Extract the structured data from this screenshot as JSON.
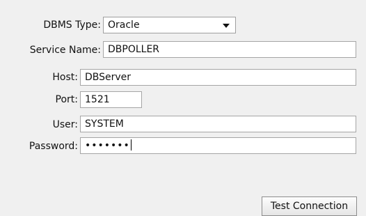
{
  "form": {
    "dbms_type": {
      "label": "DBMS Type:",
      "value": "Oracle",
      "icon": "chevron-down-icon"
    },
    "service_name": {
      "label": "Service Name:",
      "value": "DBPOLLER"
    },
    "host": {
      "label": "Host:",
      "value": "DBServer"
    },
    "port": {
      "label": "Port:",
      "value": "1521"
    },
    "user": {
      "label": "User:",
      "value": "SYSTEM"
    },
    "password": {
      "label": "Password:",
      "value_masked": "•••••••"
    }
  },
  "actions": {
    "test_connection_label": "Test Connection"
  },
  "colors": {
    "background": "#f0f0f0",
    "field_background": "#ffffff",
    "field_border": "#a5a5a5",
    "button_border": "#8c8c8c"
  }
}
